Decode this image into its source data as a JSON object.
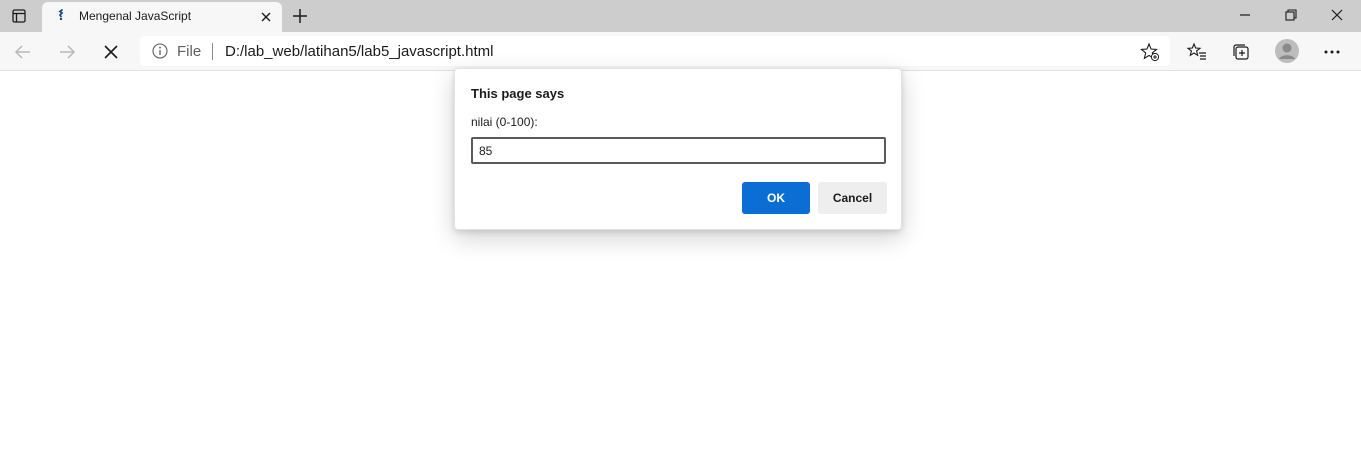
{
  "browser": {
    "tab": {
      "title": "Mengenal JavaScript"
    },
    "address": {
      "scheme": "File",
      "url": "D:/lab_web/latihan5/lab5_javascript.html"
    },
    "icons": {
      "tab_actions": "tab-actions-icon",
      "favicon": "javascript-favicon",
      "tab_close": "close-icon",
      "new_tab": "plus-icon",
      "minimize": "minimize-icon",
      "restore": "restore-icon",
      "close_window": "close-icon",
      "back": "arrow-left-icon",
      "forward": "arrow-right-icon",
      "stop": "stop-x-icon",
      "site_info": "info-icon",
      "add_favorite": "star-plus-icon",
      "favorites": "favorites-list-icon",
      "collections": "collections-icon",
      "profile": "avatar",
      "menu": "more-dots-icon"
    }
  },
  "dialog": {
    "title": "This page says",
    "message": "nilai (0-100):",
    "input_value": "85",
    "ok_label": "OK",
    "cancel_label": "Cancel"
  },
  "colors": {
    "primary_button": "#0c6dd4",
    "tabstrip": "#cdcdcd",
    "toolbar": "#f7f7f7"
  }
}
